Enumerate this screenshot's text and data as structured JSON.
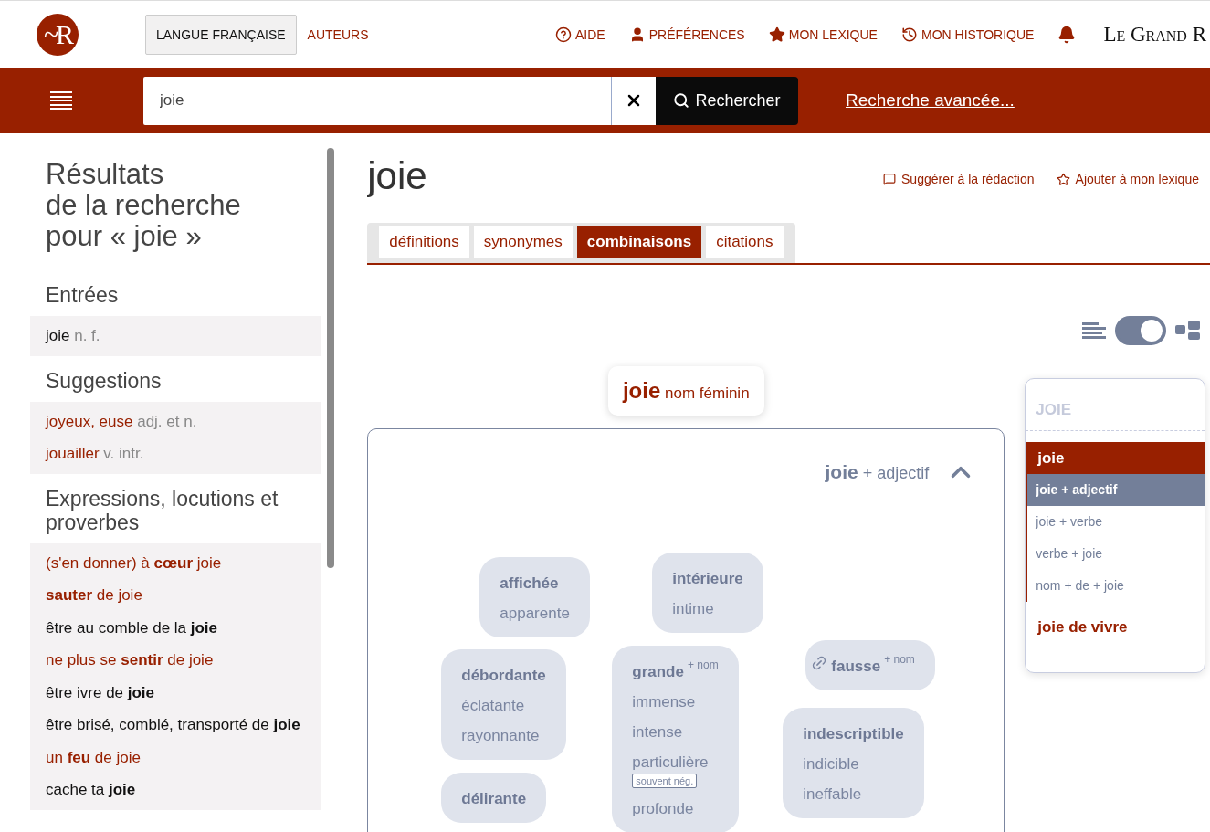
{
  "header": {
    "logo": "~R",
    "tabs": [
      {
        "label": "LANGUE FRANÇAISE",
        "selected": true
      },
      {
        "label": "AUTEURS",
        "selected": false
      }
    ],
    "links": [
      {
        "label": "AIDE",
        "kind": "help"
      },
      {
        "label": "PRÉFÉRENCES",
        "kind": "user"
      },
      {
        "label": "MON LEXIQUE",
        "kind": "star"
      },
      {
        "label": "MON HISTORIQUE",
        "kind": "history"
      }
    ],
    "brand": "Le Grand R"
  },
  "search": {
    "value": "joie",
    "button": "Rechercher",
    "advanced": "Recherche avancée..."
  },
  "sidebar": {
    "title": "Résultats\nde la recherche\npour « joie »",
    "sections": [
      {
        "heading": "Entrées",
        "items": [
          {
            "text": "joie",
            "gram": "n. f.",
            "kind": "plain"
          }
        ]
      },
      {
        "heading": "Suggestions",
        "items": [
          {
            "text": "joyeux, euse",
            "gram": "adj. et n.",
            "kind": "link"
          },
          {
            "text": "jouailler",
            "gram": "v. intr.",
            "kind": "link"
          }
        ]
      },
      {
        "heading": "Expressions, locutions et proverbes",
        "items": [
          {
            "text": "(s'en donner) à **cœur** joie",
            "kind": "link"
          },
          {
            "text": "**sauter** de joie",
            "kind": "link"
          },
          {
            "text": "être au comble de la **joie**",
            "kind": "plain"
          },
          {
            "text": "ne plus se **sentir** de joie",
            "kind": "link"
          },
          {
            "text": "être ivre de **joie**",
            "kind": "plain"
          },
          {
            "text": "être brisé, comblé, transporté de **joie**",
            "kind": "plain"
          },
          {
            "text": "un **feu** de joie",
            "kind": "link"
          },
          {
            "text": "cache ta **joie**",
            "kind": "plain"
          }
        ]
      }
    ]
  },
  "entry": {
    "title": "joie",
    "actions": [
      {
        "label": "Suggérer à la rédaction",
        "kind": "comment"
      },
      {
        "label": "Ajouter à mon lexique",
        "kind": "star"
      }
    ],
    "tabs": [
      {
        "label": "définitions",
        "selected": false
      },
      {
        "label": "synonymes",
        "selected": false
      },
      {
        "label": "combinaisons",
        "selected": true
      },
      {
        "label": "citations",
        "selected": false
      }
    ],
    "view_toggle": {
      "on": true
    }
  },
  "node": {
    "word": "joie",
    "category": "nom féminin"
  },
  "group": {
    "word": "joie",
    "pattern": "+ adjectif",
    "expanded": true,
    "bubbles": [
      {
        "linked": false,
        "words": [
          {
            "text": "affichée"
          },
          {
            "text": "apparente"
          }
        ]
      },
      {
        "linked": false,
        "words": [
          {
            "text": "intérieure"
          },
          {
            "text": "intime"
          }
        ]
      },
      {
        "linked": false,
        "words": [
          {
            "text": "débordante"
          },
          {
            "text": "éclatante"
          },
          {
            "text": "rayonnante"
          }
        ]
      },
      {
        "linked": false,
        "words": [
          {
            "text": "grande",
            "note": "+ nom"
          },
          {
            "text": "immense"
          },
          {
            "text": "intense"
          },
          {
            "text": "particulière",
            "tag": "souvent nég."
          },
          {
            "text": "profonde"
          }
        ]
      },
      {
        "linked": true,
        "words": [
          {
            "text": "fausse",
            "note": "+ nom"
          }
        ]
      },
      {
        "linked": false,
        "words": [
          {
            "text": "délirante"
          }
        ]
      },
      {
        "linked": false,
        "words": [
          {
            "text": "indescriptible"
          },
          {
            "text": "indicible"
          },
          {
            "text": "ineffable"
          }
        ]
      }
    ]
  },
  "nav": {
    "title": "JOIE",
    "entries": [
      {
        "label": "joie",
        "selected": true,
        "children": [
          {
            "label": "joie + adjectif",
            "selected": true
          },
          {
            "label": "joie + verbe",
            "selected": false
          },
          {
            "label": "verbe + joie",
            "selected": false
          },
          {
            "label": "nom + de + joie",
            "selected": false
          }
        ]
      },
      {
        "label": "joie de vivre",
        "selected": false
      }
    ]
  }
}
